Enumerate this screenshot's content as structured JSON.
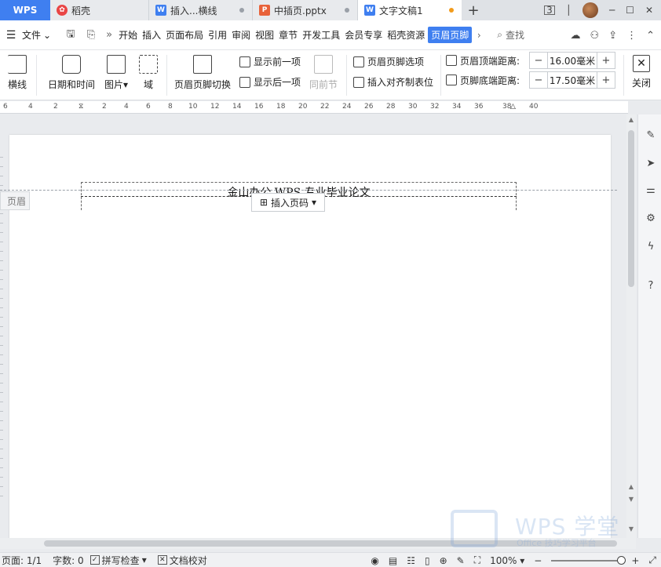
{
  "tabs": [
    {
      "label": "WPS"
    },
    {
      "label": "稻壳"
    },
    {
      "label": "插入...横线"
    },
    {
      "label": "中插页.pptx"
    },
    {
      "label": "文字文稿1"
    }
  ],
  "tab_badge": "3",
  "menubar": {
    "file": "文件",
    "items": [
      "开始",
      "插入",
      "页面布局",
      "引用",
      "审阅",
      "视图",
      "章节",
      "开发工具",
      "会员专享",
      "稻壳资源"
    ],
    "active": "页眉页脚",
    "search": "查找"
  },
  "ribbon": {
    "partial_label": "横线",
    "date_time": "日期和时间",
    "picture": "图片",
    "field": "域",
    "toggle_hf": "页眉页脚切换",
    "show_prev": "显示前一项",
    "show_next": "显示后一项",
    "same_as_prev": "同前节",
    "hf_options": "页眉页脚选项",
    "insert_align_tab": "插入对齐制表位",
    "header_top_label": "页眉顶端距离:",
    "header_top_value": "16.00毫米",
    "footer_bottom_label": "页脚底端距离:",
    "footer_bottom_value": "17.50毫米",
    "close": "关闭"
  },
  "ruler_labels": [
    "6",
    "4",
    "2",
    "2",
    "4",
    "6",
    "8",
    "10",
    "12",
    "14",
    "16",
    "18",
    "20",
    "22",
    "24",
    "26",
    "28",
    "30",
    "32",
    "34",
    "36",
    "38",
    "40"
  ],
  "document": {
    "header_text": "金山办公 WPS 专业毕业论文",
    "header_tag": "页眉",
    "insert_page_number": "插入页码"
  },
  "statusbar": {
    "page": "页面: 1/1",
    "words": "字数: 0",
    "spell": "拼写检查",
    "proof": "文档校对",
    "zoom": "100%"
  },
  "watermark": {
    "brand": "WPS 学堂",
    "tagline": "Office 技巧学习平台"
  },
  "colors": {
    "accent": "#3f7ff0",
    "unsaved_dot": "#f29b1b"
  }
}
